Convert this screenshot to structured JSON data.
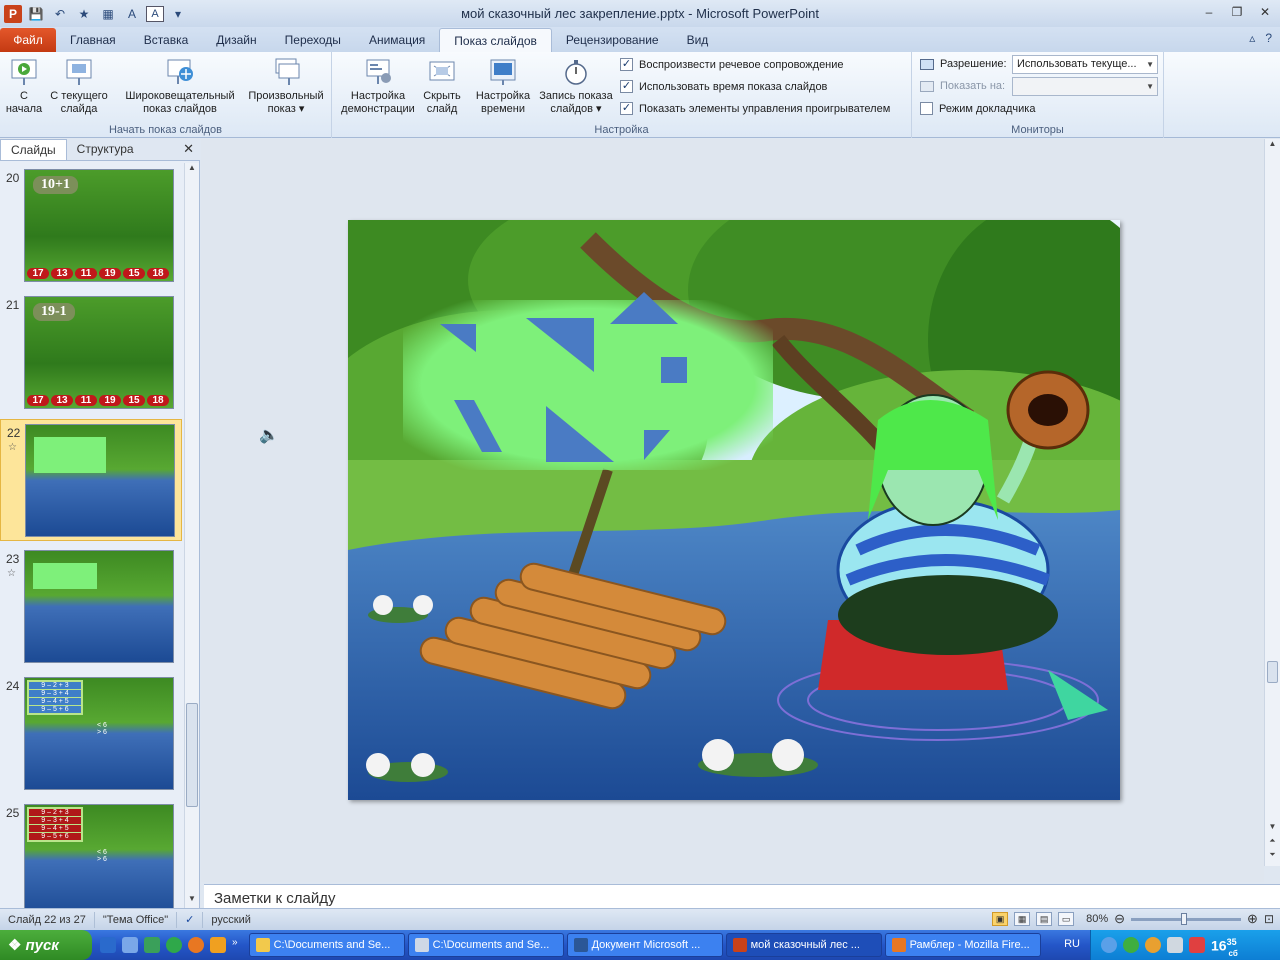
{
  "window": {
    "title": "мой сказочный лес  закрепление.pptx - Microsoft PowerPoint",
    "font_btn": "A"
  },
  "ribbon_tabs": [
    {
      "label": "Файл",
      "kind": "file"
    },
    {
      "label": "Главная"
    },
    {
      "label": "Вставка"
    },
    {
      "label": "Дизайн"
    },
    {
      "label": "Переходы"
    },
    {
      "label": "Анимация"
    },
    {
      "label": "Показ слайдов",
      "active": true
    },
    {
      "label": "Рецензирование"
    },
    {
      "label": "Вид"
    }
  ],
  "ribbon": {
    "start_group": {
      "label": "Начать показ слайдов",
      "from_start": "С\nначала",
      "from_current": "С текущего\nслайда",
      "broadcast": "Широковещательный\nпоказ слайдов",
      "custom": "Произвольный\nпоказ ▾"
    },
    "setup_group": {
      "label": "Настройка",
      "setup_show": "Настройка\nдемонстрации",
      "hide_slide": "Скрыть\nслайд",
      "rehearse": "Настройка\nвремени",
      "record": "Запись показа\nслайдов ▾",
      "play_narrations": "Воспроизвести речевое сопровождение",
      "use_timings": "Использовать время показа слайдов",
      "show_controls": "Показать элементы управления проигрывателем"
    },
    "monitors_group": {
      "label": "Мониторы",
      "resolution_label": "Разрешение:",
      "resolution_value": "Использовать текуще...",
      "show_on_label": "Показать на:",
      "presenter_view": "Режим докладчика"
    }
  },
  "pane": {
    "tab_slides": "Слайды",
    "tab_outline": "Структура",
    "close": "✕"
  },
  "thumbnails": [
    {
      "num": "20",
      "label": "10+1",
      "numbers": [
        "17",
        "13",
        "11",
        "19",
        "15",
        "18"
      ]
    },
    {
      "num": "21",
      "label": "19-1",
      "numbers": [
        "17",
        "13",
        "11",
        "19",
        "15",
        "18"
      ]
    },
    {
      "num": "22",
      "selected": true,
      "star": "☆"
    },
    {
      "num": "23",
      "star": "☆"
    },
    {
      "num": "24",
      "eqs": [
        "9 – 2 + 3",
        "9 – 3 + 4",
        "9 – 4 + 5",
        "9 – 5 + 6"
      ],
      "marks": [
        "< 6",
        "> 6"
      ]
    },
    {
      "num": "25",
      "eqs": [
        "9 – 2 + 3",
        "9 – 3 + 4",
        "9 – 4 + 5",
        "9 – 5 + 6"
      ],
      "marks": [
        "< 6",
        "> 6"
      ]
    }
  ],
  "notes_placeholder": "Заметки к слайду",
  "status": {
    "slide_info": "Слайд 22 из 27",
    "theme": "\"Тема Office\"",
    "language": "русский",
    "zoom": "80%"
  },
  "taskbar": {
    "start": "пуск",
    "tasks": [
      {
        "label": "C:\\Documents and Se...",
        "color": "#f2c94c"
      },
      {
        "label": "C:\\Documents and Se...",
        "color": "#cfd8e6"
      },
      {
        "label": "Документ Microsoft ...",
        "color": "#2b5797"
      },
      {
        "label": "мой сказочный лес ...",
        "color": "#c9421a",
        "active": true
      },
      {
        "label": "Рамблер - Mozilla Fire...",
        "color": "#e87722"
      }
    ],
    "lang": "RU",
    "clock_h": "16",
    "clock_m": "35",
    "clock_day": "сб"
  },
  "colors": {
    "shape_blue": "#4a7bc4",
    "green_panel": "#7ef07a",
    "raft": "#d48a3a",
    "water": "#2e5fa8"
  }
}
